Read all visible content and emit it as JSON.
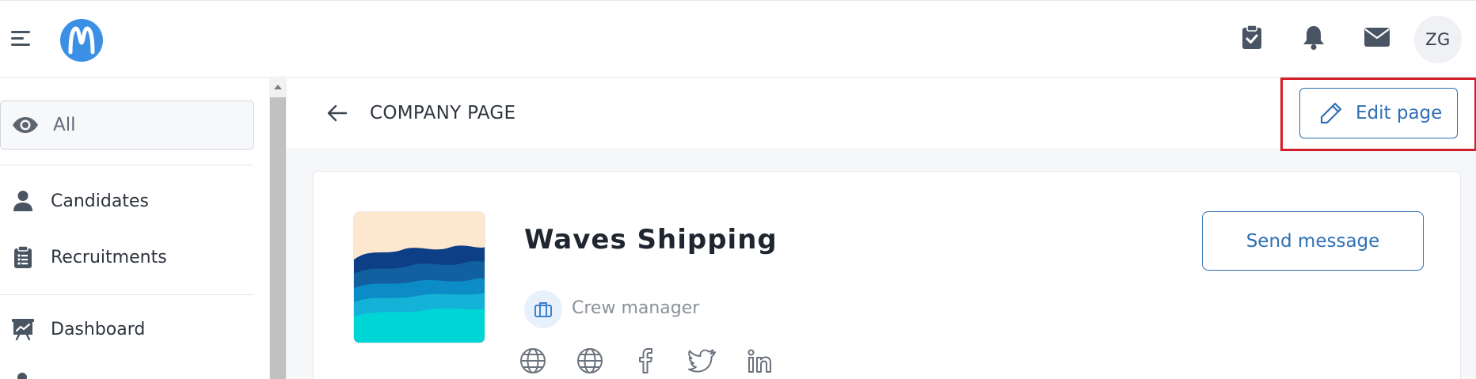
{
  "header": {
    "avatar_initials": "ZG",
    "icons": [
      "menu-icon",
      "logo",
      "clipboard-check-icon",
      "bell-icon",
      "envelope-icon"
    ]
  },
  "sidebar": {
    "filter": {
      "label": "All",
      "icon": "eye-icon"
    },
    "items": [
      {
        "label": "Candidates",
        "icon": "person-icon"
      },
      {
        "label": "Recruitments",
        "icon": "clipboard-list-icon"
      },
      {
        "label": "Dashboard",
        "icon": "presentation-chart-icon"
      }
    ]
  },
  "page": {
    "title": "COMPANY PAGE",
    "edit_label": "Edit page"
  },
  "company": {
    "name": "Waves Shipping",
    "role": "Crew manager",
    "send_label": "Send message",
    "social_icons": [
      "globe-icon",
      "globe-icon",
      "facebook-icon",
      "twitter-icon",
      "linkedin-icon"
    ]
  },
  "colors": {
    "accent": "#2f6fb5",
    "logo_blue": "#3b8fe4",
    "highlight_red": "#d41e2a"
  }
}
